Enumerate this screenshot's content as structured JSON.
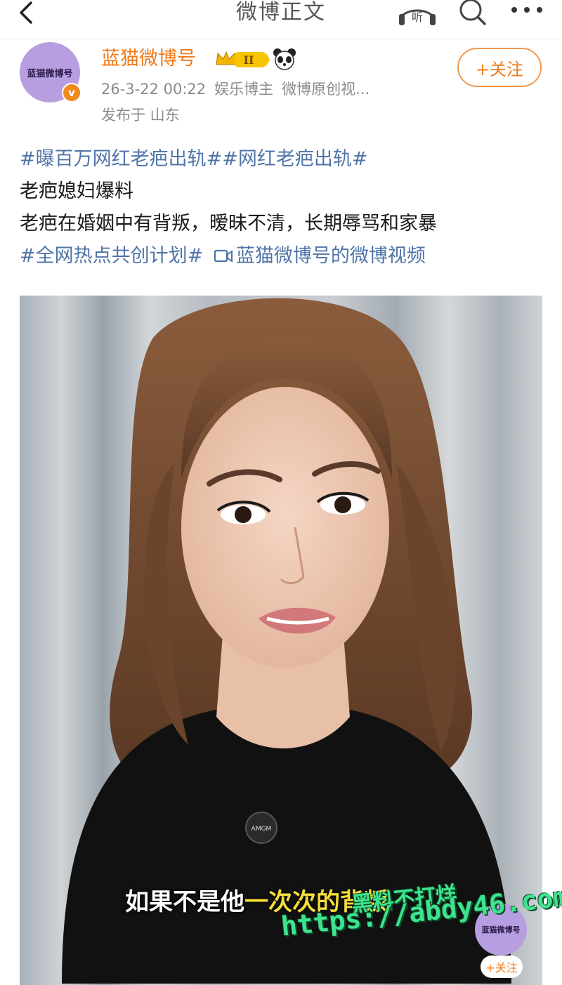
{
  "nav": {
    "title": "微博正文",
    "listen_label": "听"
  },
  "author": {
    "name": "蓝猫微博号",
    "avatar_text": "蓝猫微博号",
    "verified_mark": "v",
    "level_badge": "II",
    "date": "26-3-22 00:22",
    "category": "娱乐博主",
    "source": "微博原创视...",
    "location": "发布于 山东",
    "follow_label": "+关注"
  },
  "post": {
    "line1_tags": "#曝百万网红老疤出轨##网红老疤出轨#",
    "line2": "老疤媳妇爆料",
    "line3": "老疤在婚姻中有背叛，暧昧不清，长期辱骂和家暴",
    "line4_tag": "#全网热点共创计划#",
    "line4_video_link": "蓝猫微博号的微博视频"
  },
  "video": {
    "subtitle_white": "如果不是他",
    "subtitle_yellow": "一次次的背叛",
    "mic_label": "AMGM",
    "mini_avatar_text": "蓝猫微博号",
    "mini_follow_label": "+关注"
  },
  "watermark": {
    "line1": "黑料不打烊",
    "line2": "https://abdy46.com"
  },
  "colors": {
    "accent_orange": "#f07a1a",
    "tag_blue": "#5074a8",
    "avatar_purple": "#b79ee0",
    "subtitle_yellow": "#f3dd3a",
    "watermark_green": "#3fe38f"
  },
  "icons": [
    "back-arrow-icon",
    "listen-headphones-icon",
    "search-icon",
    "more-dots-icon",
    "crown-badge-icon",
    "panda-icon",
    "verified-icon",
    "video-camera-icon"
  ]
}
